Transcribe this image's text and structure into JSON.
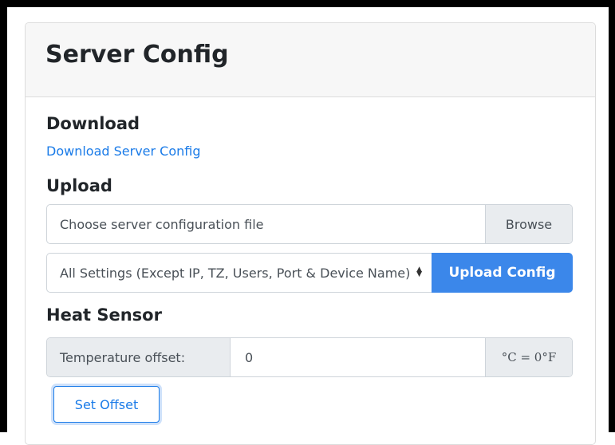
{
  "card": {
    "title": "Server Config"
  },
  "download": {
    "heading": "Download",
    "link_label": "Download Server Config"
  },
  "upload": {
    "heading": "Upload",
    "file_placeholder": "Choose server configuration file",
    "browse_label": "Browse",
    "select_value": "All Settings (Except IP, TZ, Users, Port & Device Name)",
    "upload_button_label": "Upload Config"
  },
  "heat_sensor": {
    "heading": "Heat Sensor",
    "offset_label": "Temperature offset:",
    "offset_value": "0",
    "unit_label": "°C = 0°F",
    "set_button_label": "Set Offset"
  },
  "colors": {
    "accent": "#3b87ea",
    "link": "#1a7be8",
    "header_bg": "#f7f7f7",
    "addon_bg": "#e9ecef"
  },
  "icons": {
    "select_arrow": "select-arrow-icon"
  }
}
